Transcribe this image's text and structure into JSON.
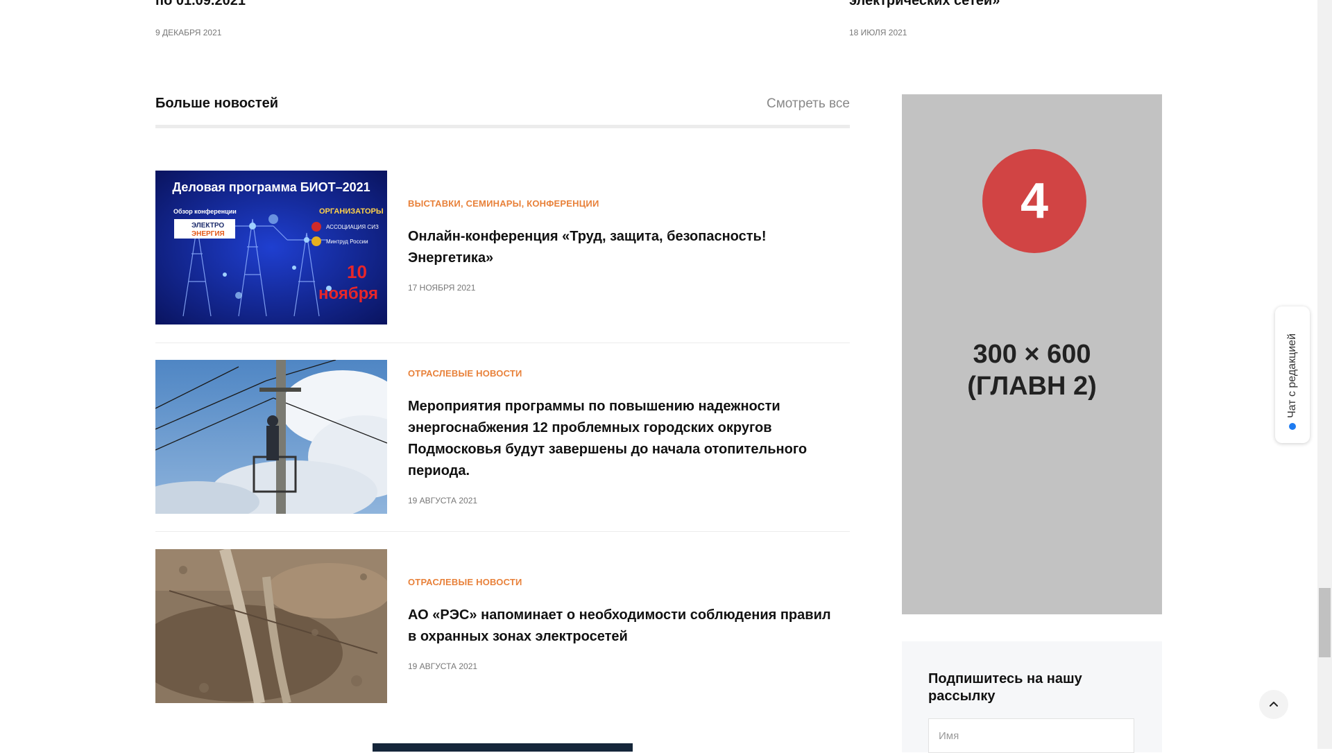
{
  "top_items": [
    {
      "title": "по 01.09.2021",
      "date": "9 ДЕКАБРЯ 2021"
    },
    {
      "title": "электрических сетей»",
      "date": "18 ИЮЛЯ 2021"
    }
  ],
  "section": {
    "title": "Больше новостей",
    "see_all": "Смотреть все"
  },
  "news": [
    {
      "category": "ВЫСТАВКИ, СЕМИНАРЫ, КОНФЕРЕНЦИИ",
      "title": "Онлайн-конференция «Труд, защита, безопасность! Энергетика»",
      "date": "17 НОЯБРЯ 2021",
      "thumb": {
        "heading": "Деловая программа БИОТ–2021",
        "subtitle": "Обзор конференции",
        "logo_line1": "ЭЛЕКТРО",
        "logo_line2": "ЭНЕРГИЯ",
        "organizers": "ОРГАНИЗАТОРЫ",
        "org1": "АССОЦИАЦИЯ СИЗ",
        "org2": "Минтруд России",
        "day": "10",
        "month": "ноября"
      }
    },
    {
      "category": "ОТРАСЛЕВЫЕ НОВОСТИ",
      "title": "Мероприятия программы по повышению надежности энергоснабжения 12 проблемных городских округов Подмосковья будут завершены до начала отопительного периода.",
      "date": "19 АВГУСТА 2021"
    },
    {
      "category": "ОТРАСЛЕВЫЕ НОВОСТИ",
      "title": "АО «РЭС» напоминает о необходимости соблюдения правил в охранных зонах электросетей",
      "date": "19 АВГУСТА 2021"
    }
  ],
  "ad": {
    "number": "4",
    "line1": "300 × 600",
    "line2": "(ГЛАВН 2)"
  },
  "subscribe": {
    "title": "Подпишитесь на нашу рассылку",
    "name_placeholder": "Имя"
  },
  "chat": {
    "label": "Чат с редакцией"
  }
}
